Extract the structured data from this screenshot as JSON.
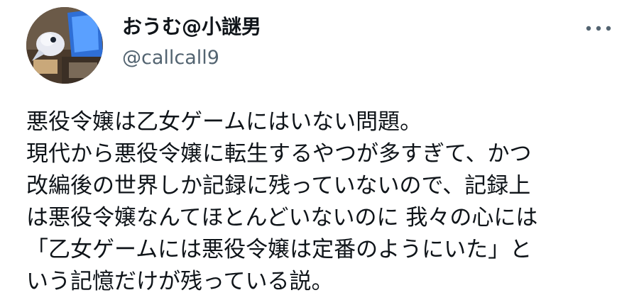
{
  "user": {
    "display_name": "おうむ@小謎男",
    "handle": "@callcall9",
    "avatar_icon": "profile-photo"
  },
  "menu": {
    "icon": "more-horizontal-icon"
  },
  "tweet": {
    "lines": [
      "悪役令嬢は乙女ゲームにはいない問題。",
      "現代から悪役令嬢に転生するやつが多すぎて、かつ",
      "改編後の世界しか記録に残っていないので、記録上",
      "は悪役令嬢なんてほとんどいないのに 我々の心には",
      "「乙女ゲームには悪役令嬢は定番のようにいた」と",
      "いう記憶だけが残っている説。"
    ]
  },
  "colors": {
    "text": "#0f1419",
    "secondary": "#536471",
    "background": "#ffffff"
  }
}
